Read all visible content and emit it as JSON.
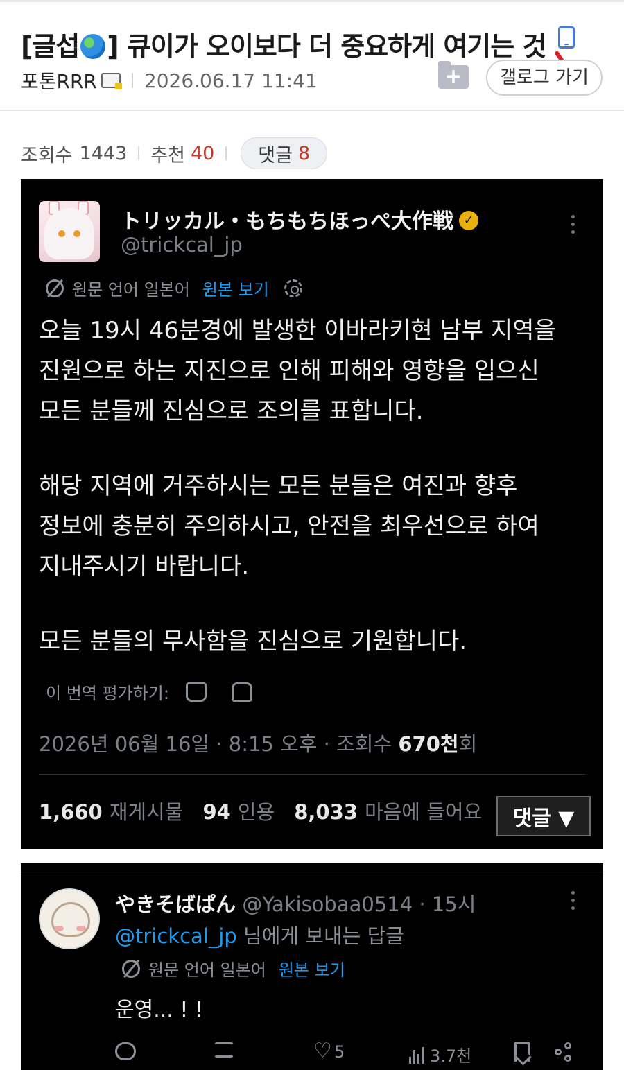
{
  "post": {
    "title_prefix": "[글섭",
    "title_rest": "] 큐이가 오이보다 더 중요하게 여기는 것",
    "author": "포톤RRR",
    "date": "2026.06.17 11:41",
    "gallog_button": "갤로그 가기",
    "folder_icon": "+"
  },
  "stats": {
    "views_label": "조회수",
    "views": "1443",
    "recommend_label": "추천",
    "recommend": "40",
    "comments_label": "댓글",
    "comments": "8"
  },
  "tweet": {
    "display_name": "トリッカル・もちもちほっぺ大作戦",
    "handle": "@trickcal_jp",
    "translation_note": "원문 언어 일본어",
    "view_original": "원본 보기",
    "paragraphs": [
      [
        "오늘 19시 46분경에 발생한 이바라키현 남부 지역을",
        "진원으로 하는 지진으로 인해 피해와 영향을 입으신",
        "모든 분들께 진심으로 조의를 표합니다."
      ],
      [
        "해당 지역에 거주하시는 모든 분들은 여진과 향후",
        "정보에 충분히 주의하시고, 안전을 최우선으로 하여",
        "지내주시기 바랍니다."
      ],
      [
        "모든 분들의 무사함을 진심으로 기원합니다."
      ]
    ],
    "rate_label": "이 번역 평가하기:",
    "timestamp": "2026년 06월 16일 · 8:15 오후 · 조회수 ",
    "views_count": "670천",
    "views_suffix": "회",
    "reposts": "1,660",
    "reposts_label": "재게시물",
    "quotes": "94",
    "quotes_label": "인용",
    "likes": "8,033",
    "likes_label": "마음에 들어요",
    "reply_button": "댓글 ▼"
  },
  "reply": {
    "display_name": "やきそばぱん",
    "handle_time": "@Yakisobaa0514 · 15시",
    "reply_to_handle": "@trickcal_jp",
    "reply_to_suffix": " 님에게 보내는 답글",
    "translation_note": "원문 언어 일본어",
    "view_original": "원본 보기",
    "text": "운영... ! !",
    "likes": "5",
    "views": "3.7천"
  }
}
